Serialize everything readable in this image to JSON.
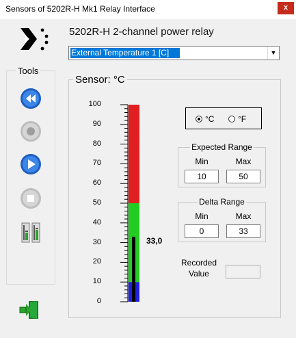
{
  "window": {
    "title": "Sensors of 5202R-H Mk1 Relay   Interface",
    "close_glyph": "x"
  },
  "device_title": "5202R-H  2-channel power relay",
  "sensor_select": {
    "value": "External Temperature 1 [C]"
  },
  "tools": {
    "label": "Tools",
    "buttons": [
      "rewind-icon",
      "record-icon",
      "play-icon",
      "stop-icon",
      "meters-icon"
    ]
  },
  "sensor": {
    "label": "Sensor: °C",
    "scale": [
      "100",
      "90",
      "80",
      "70",
      "60",
      "50",
      "40",
      "30",
      "20",
      "10",
      "0"
    ],
    "reading": "33,0",
    "reading_value": 33.0,
    "range_min": 0,
    "range_max": 100,
    "zones": {
      "low_end": 10,
      "normal_end": 50
    },
    "colors": {
      "high": "#e02020",
      "normal": "#22cc22",
      "low": "#2020dd",
      "level": "#000000"
    }
  },
  "units": {
    "celsius_label": "°C",
    "fahrenheit_label": "°F",
    "selected": "celsius"
  },
  "expected_range": {
    "title": "Expected Range",
    "min_label": "Min",
    "max_label": "Max",
    "min": "10",
    "max": "50"
  },
  "delta_range": {
    "title": "Delta Range",
    "min_label": "Min",
    "max_label": "Max",
    "min": "0",
    "max": "33"
  },
  "recorded": {
    "label_line1": "Recorded",
    "label_line2": "Value",
    "value": ""
  }
}
